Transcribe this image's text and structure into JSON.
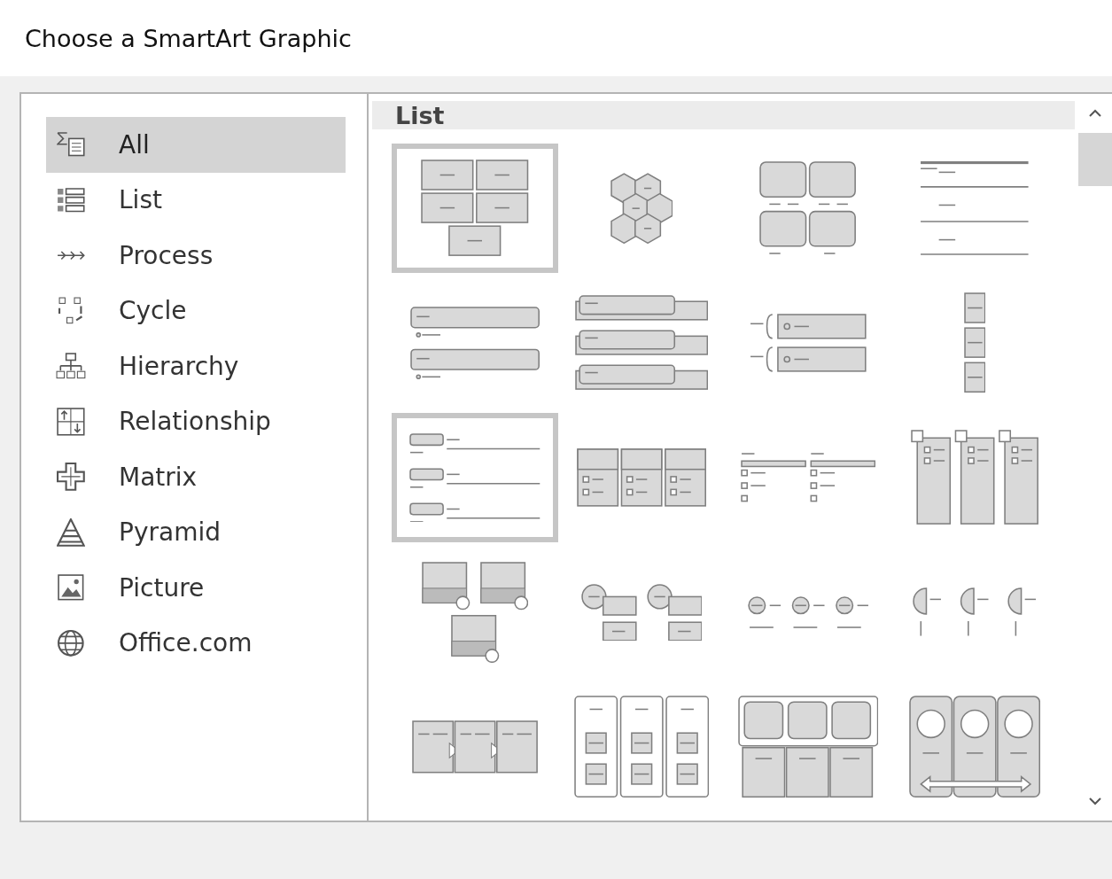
{
  "window": {
    "title": "Choose a SmartArt Graphic"
  },
  "categories": [
    {
      "label": "All",
      "selected": true
    },
    {
      "label": "List",
      "selected": false
    },
    {
      "label": "Process",
      "selected": false
    },
    {
      "label": "Cycle",
      "selected": false
    },
    {
      "label": "Hierarchy",
      "selected": false
    },
    {
      "label": "Relationship",
      "selected": false
    },
    {
      "label": "Matrix",
      "selected": false
    },
    {
      "label": "Pyramid",
      "selected": false
    },
    {
      "label": "Picture",
      "selected": false
    },
    {
      "label": "Office.com",
      "selected": false
    }
  ],
  "gallery": {
    "heading": "List",
    "layouts": [
      {
        "selected": true
      },
      {
        "selected": false
      },
      {
        "selected": false
      },
      {
        "selected": false
      },
      {
        "selected": false
      },
      {
        "selected": false
      },
      {
        "selected": false
      },
      {
        "selected": false
      },
      {
        "selected": true
      },
      {
        "selected": false
      },
      {
        "selected": false
      },
      {
        "selected": false
      },
      {
        "selected": false
      },
      {
        "selected": false
      },
      {
        "selected": false
      },
      {
        "selected": false
      },
      {
        "selected": false
      },
      {
        "selected": false
      },
      {
        "selected": false
      },
      {
        "selected": false
      }
    ]
  }
}
